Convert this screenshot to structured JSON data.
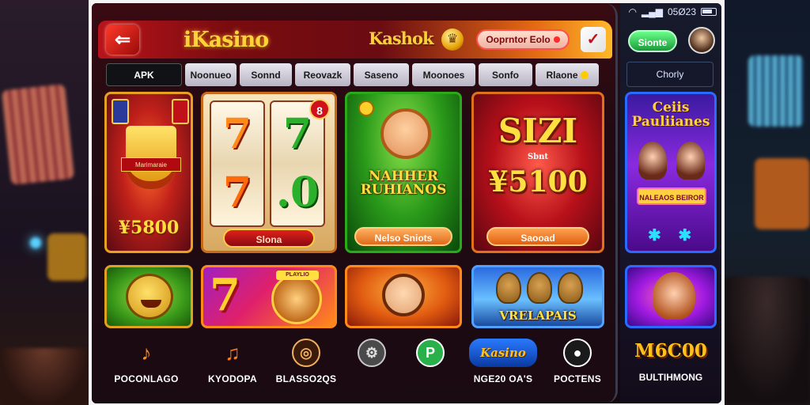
{
  "status_bar": {
    "time": "05Ø23"
  },
  "header": {
    "logo_glyph": "⇐",
    "brand": "iKasino",
    "brand_secondary": "Kashok",
    "deposit_label": "Ooprntor Eolo",
    "flag_glyph": "✓"
  },
  "tabs": [
    {
      "label": "APK",
      "active": true
    },
    {
      "label": "Noonueo"
    },
    {
      "label": "Sonnd"
    },
    {
      "label": "Reovazk"
    },
    {
      "label": "Saseno"
    },
    {
      "label": "Moonoes"
    },
    {
      "label": "Sonfo"
    },
    {
      "label": "Rlaone"
    }
  ],
  "games": {
    "trophy": {
      "title": "¥5800",
      "cup_label": "Marimaraie"
    },
    "slots": {
      "digits": [
        "7",
        "7",
        "7",
        ".0"
      ],
      "badge": "8",
      "button": "Slona"
    },
    "green": {
      "title": "NAHHER RUHIANOS",
      "button": "Nelso Sniots"
    },
    "red": {
      "line1": "SIZI",
      "line2": "Sbnt",
      "line3": "¥5100",
      "button": "Saooad"
    },
    "mascot": {},
    "seven": {
      "glyph": "7",
      "tag": "PLAYLIO"
    },
    "girl": {},
    "animals": {
      "title": "VRELAPAIS"
    }
  },
  "dock": [
    {
      "label": "POCONLAGO",
      "icon": "music-note-icon",
      "glyph": "♪",
      "color": "#ff8a1a"
    },
    {
      "label": "KYODOPA",
      "icon": "music-logo-icon",
      "glyph": "♫",
      "color": "#ff7a10"
    },
    {
      "label": "BLASSO2QS",
      "icon": "badge-icon",
      "glyph": "◎",
      "color": "#f0b060"
    },
    {
      "label": "",
      "icon": "chip-icon",
      "glyph": "⚙",
      "color": "#c8c8c8"
    },
    {
      "label": "",
      "icon": "p-icon",
      "glyph": "P",
      "color": "#2ab04a"
    },
    {
      "label": "NGE20 OA'S",
      "icon": "kasino-logo-icon",
      "glyph": "Kasino",
      "color": "#2a7aff"
    },
    {
      "label": "POCTENS",
      "icon": "person-icon",
      "glyph": "●",
      "color": "#ffffff"
    }
  ],
  "side": {
    "sign_label": "Sionte",
    "tab_label": "Chorly",
    "card_title": "Ceiis Pauliianes",
    "card_subtitle": "NALEAOS BEIROR",
    "card_icons": "✱ ✱",
    "dock_title": "M6C00",
    "dock_label": "BULTIHMONG"
  }
}
